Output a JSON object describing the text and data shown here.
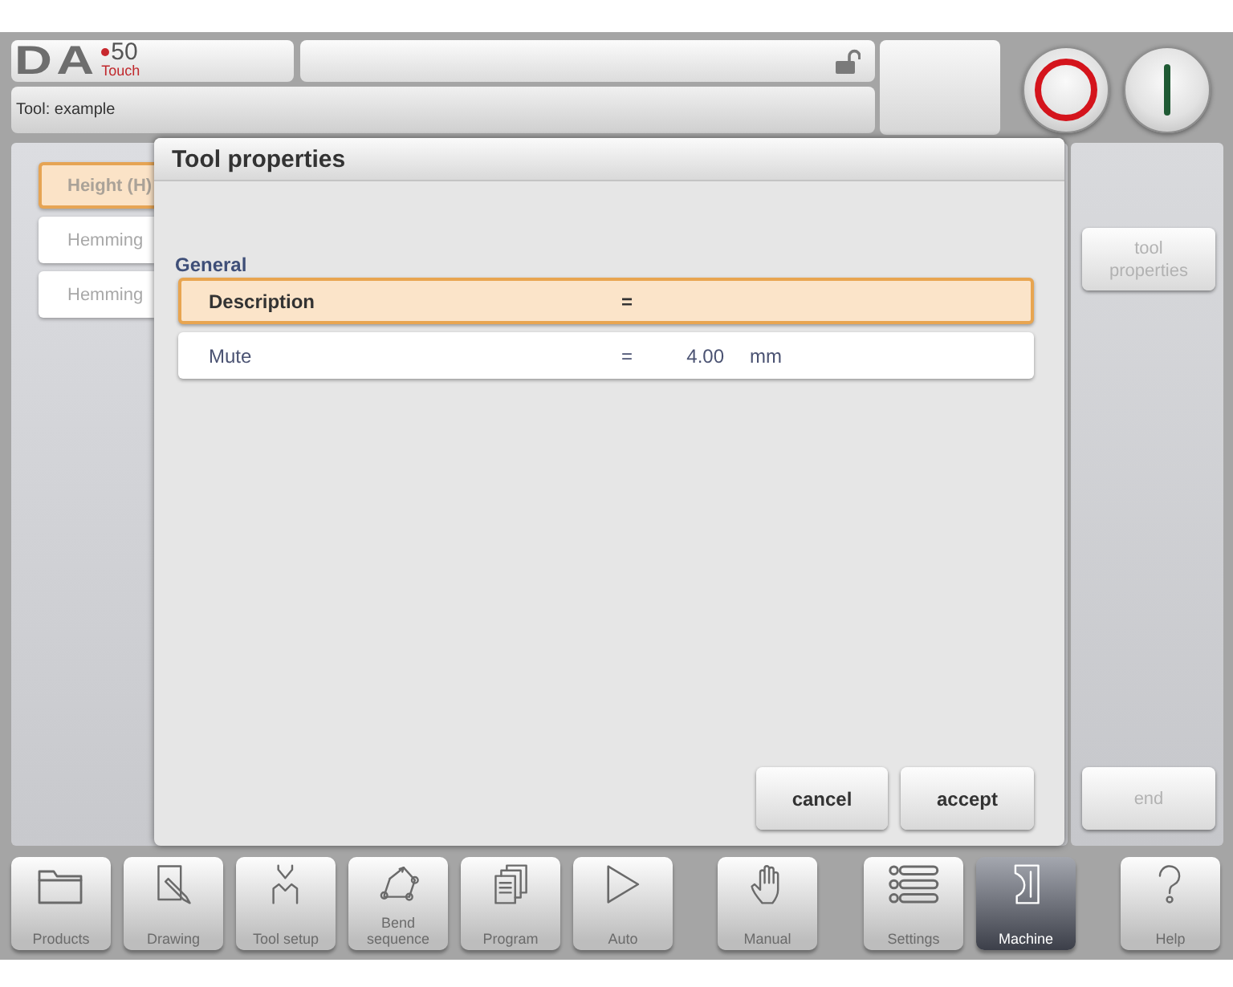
{
  "header": {
    "logo": {
      "letters": "DA",
      "number": "50",
      "subtitle": "Touch"
    },
    "lock": {
      "locked": false
    },
    "tool_label": "Tool: example"
  },
  "machine_buttons": [
    {
      "kind": "stop"
    },
    {
      "kind": "start"
    }
  ],
  "side_list": [
    {
      "label": "Height (H)",
      "selected": true
    },
    {
      "label": "Hemming",
      "selected": false
    },
    {
      "label": "Hemming",
      "selected": false
    }
  ],
  "dialog": {
    "title": "Tool properties",
    "section": "General",
    "rows": [
      {
        "label": "Description",
        "sign": "=",
        "selected": true
      },
      {
        "label": "Mute",
        "sign": "=",
        "value": "4.00",
        "unit": "mm",
        "selected": false
      }
    ],
    "buttons": [
      "cancel",
      "accept"
    ]
  },
  "side_buttons": [
    {
      "label": "tool properties",
      "disabled": true
    },
    {
      "label": "end",
      "disabled": true
    }
  ],
  "toolbar": [
    {
      "label": "Products",
      "kind": "folder",
      "selected": false
    },
    {
      "label": "Drawing",
      "kind": "drawing",
      "selected": false
    },
    {
      "label": "Tool setup",
      "kind": "tools",
      "selected": false
    },
    {
      "label": "Bend sequence",
      "kind": "bend",
      "selected": false
    },
    {
      "label": "Program",
      "kind": "pages",
      "selected": false
    },
    {
      "label": "Auto",
      "kind": "play",
      "selected": false
    },
    {
      "label": "Manual",
      "kind": "hand",
      "selected": false
    },
    {
      "label": "Settings",
      "kind": "list",
      "selected": false
    },
    {
      "label": "Machine",
      "kind": "machine",
      "selected": true
    },
    {
      "label": "Help",
      "kind": "help",
      "selected": false
    }
  ]
}
